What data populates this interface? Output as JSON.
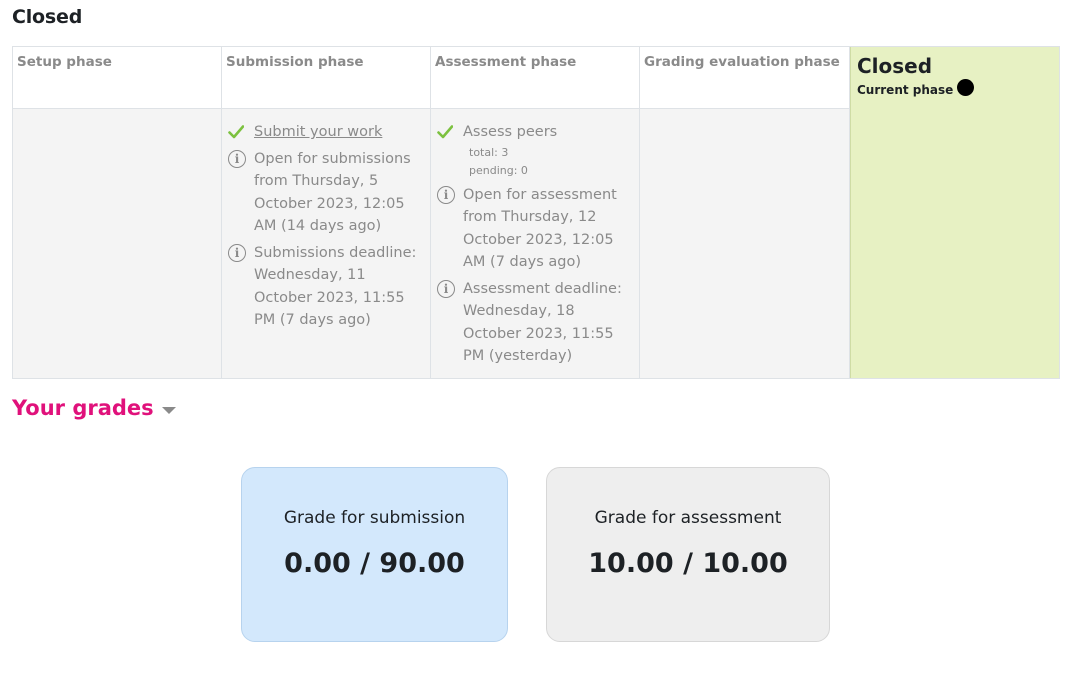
{
  "page": {
    "heading": "Closed"
  },
  "phases": [
    {
      "title": "Setup phase"
    },
    {
      "title": "Submission phase",
      "tasks": [
        {
          "icon": "check-icon",
          "text": "Submit your work"
        },
        {
          "icon": "info-icon",
          "text": "Open for submissions from Thursday, 5 October 2023, 12:05 AM (14 days ago)"
        },
        {
          "icon": "info-icon",
          "text": "Submissions deadline: Wednesday, 11 October 2023, 11:55 PM (7 days ago)"
        }
      ]
    },
    {
      "title": "Assessment phase",
      "tasks": [
        {
          "icon": "check-icon",
          "text": "Assess peers",
          "details": [
            "total: 3",
            "pending: 0"
          ]
        },
        {
          "icon": "info-icon",
          "text": "Open for assessment from Thursday, 12 October 2023, 12:05 AM (7 days ago)"
        },
        {
          "icon": "info-icon",
          "text": "Assessment deadline: Wednesday, 18 October 2023, 11:55 PM (yesterday)"
        }
      ]
    },
    {
      "title": "Grading evaluation phase"
    },
    {
      "title": "Closed",
      "current_label": "Current phase"
    }
  ],
  "grades": {
    "toggle_label": "Your grades",
    "submission": {
      "title": "Grade for submission",
      "value": "0.00 / 90.00"
    },
    "assessment": {
      "title": "Grade for assessment",
      "value": "10.00 / 10.00"
    }
  },
  "colors": {
    "accent": "#e0117b",
    "current_phase_bg": "#e7f1c3",
    "check": "#7cc13f",
    "submission_card_bg": "#d3e8fc",
    "assessment_card_bg": "#eeeeee"
  }
}
